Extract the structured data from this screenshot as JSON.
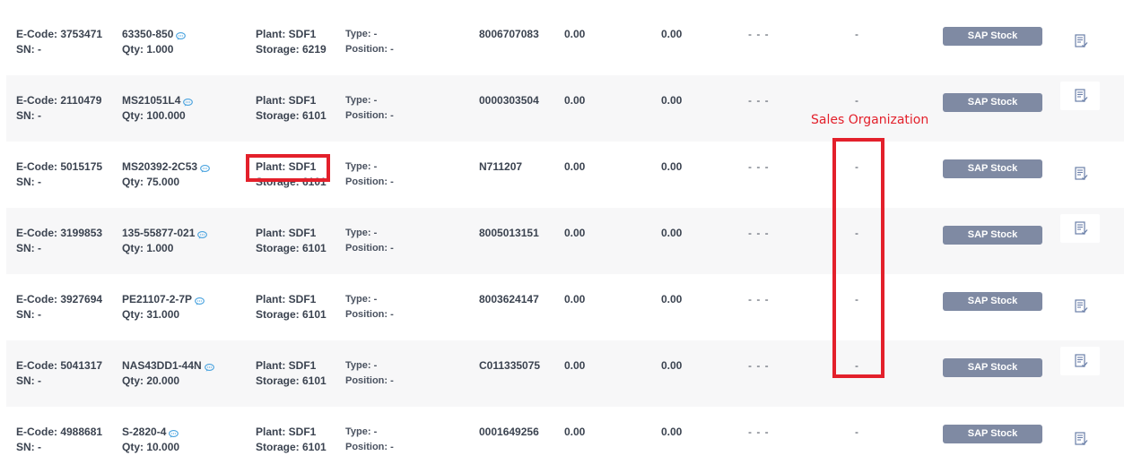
{
  "rows": [
    {
      "ecode": "E-Code: 3753471",
      "sn": "SN: -",
      "part": "63350-850",
      "qty": "Qty: 1.000",
      "plant": "Plant: SDF1",
      "storage": "Storage: 6219",
      "type": "Type: -",
      "position": "Position: -",
      "ref": "8006707083",
      "v1": "0.00",
      "v2": "0.00",
      "dashes": "- - -",
      "sales_org": "-",
      "button": "SAP Stock"
    },
    {
      "ecode": "E-Code: 2110479",
      "sn": "SN: -",
      "part": "MS21051L4",
      "qty": "Qty: 100.000",
      "plant": "Plant: SDF1",
      "storage": "Storage: 6101",
      "type": "Type: -",
      "position": "Position: -",
      "ref": "0000303504",
      "v1": "0.00",
      "v2": "0.00",
      "dashes": "- - -",
      "sales_org": "-",
      "button": "SAP Stock"
    },
    {
      "ecode": "E-Code: 5015175",
      "sn": "SN: -",
      "part": "MS20392-2C53",
      "qty": "Qty: 75.000",
      "plant": "Plant: SDF1",
      "storage": "Storage: 6101",
      "type": "Type: -",
      "position": "Position: -",
      "ref": "N711207",
      "v1": "0.00",
      "v2": "0.00",
      "dashes": "- - -",
      "sales_org": "-",
      "button": "SAP Stock"
    },
    {
      "ecode": "E-Code: 3199853",
      "sn": "SN: -",
      "part": "135-55877-021",
      "qty": "Qty: 1.000",
      "plant": "Plant: SDF1",
      "storage": "Storage: 6101",
      "type": "Type: -",
      "position": "Position: -",
      "ref": "8005013151",
      "v1": "0.00",
      "v2": "0.00",
      "dashes": "- - -",
      "sales_org": "-",
      "button": "SAP Stock"
    },
    {
      "ecode": "E-Code: 3927694",
      "sn": "SN: -",
      "part": "PE21107-2-7P",
      "qty": "Qty: 31.000",
      "plant": "Plant: SDF1",
      "storage": "Storage: 6101",
      "type": "Type: -",
      "position": "Position: -",
      "ref": "8003624147",
      "v1": "0.00",
      "v2": "0.00",
      "dashes": "- - -",
      "sales_org": "-",
      "button": "SAP Stock"
    },
    {
      "ecode": "E-Code: 5041317",
      "sn": "SN: -",
      "part": "NAS43DD1-44N",
      "qty": "Qty: 20.000",
      "plant": "Plant: SDF1",
      "storage": "Storage: 6101",
      "type": "Type: -",
      "position": "Position: -",
      "ref": "C011335075",
      "v1": "0.00",
      "v2": "0.00",
      "dashes": "- - -",
      "sales_org": "-",
      "button": "SAP Stock"
    },
    {
      "ecode": "E-Code: 4988681",
      "sn": "SN: -",
      "part": "S-2820-4",
      "qty": "Qty: 10.000",
      "plant": "Plant: SDF1",
      "storage": "Storage: 6101",
      "type": "Type: -",
      "position": "Position: -",
      "ref": "0001649256",
      "v1": "0.00",
      "v2": "0.00",
      "dashes": "- - -",
      "sales_org": "-",
      "button": "SAP Stock"
    }
  ],
  "annotation": {
    "label": "Sales Organization",
    "color": "#e3202b"
  },
  "colors": {
    "button_bg": "#7f8aa3",
    "chat_icon": "#4aa3df",
    "row_alt_bg": "#f7f7f8"
  },
  "icons": {
    "part_note": "chat-bubble-icon",
    "row_action": "edit-document-icon"
  }
}
